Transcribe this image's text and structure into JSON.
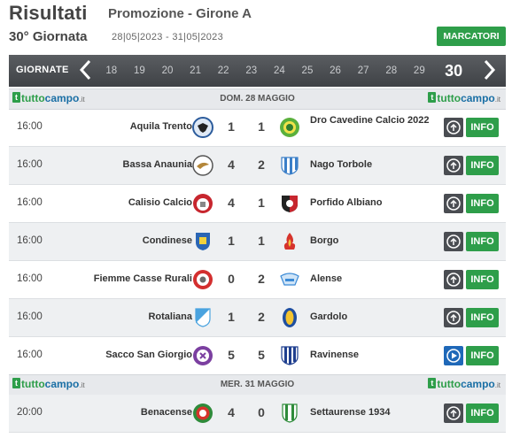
{
  "header": {
    "title": "Risultati",
    "subtitle": "Promozione - Girone A",
    "round_label": "30° Giornata",
    "date_range": "28|05|2023 - 31|05|2023",
    "scorers_button": "MARCATORI"
  },
  "round_nav": {
    "label": "GIORNATE",
    "rounds": [
      "18",
      "19",
      "20",
      "21",
      "22",
      "23",
      "24",
      "25",
      "26",
      "27",
      "28",
      "29"
    ],
    "current": "30"
  },
  "brand": {
    "name_a": "tutto",
    "name_b": "campo",
    "suffix": ".it"
  },
  "days": [
    {
      "label": "DOM. 28 MAGGIO"
    },
    {
      "label": "MER. 31 MAGGIO"
    }
  ],
  "matches": [
    {
      "time": "16:00",
      "home": "Aquila Trento",
      "home_goals": "1",
      "away_goals": "1",
      "away": "Dro Cavedine Calcio 2022",
      "home_logo": "eagle-crest-icon",
      "away_logo": "green-circle-crest-icon",
      "action_icon": "upload-icon",
      "info": "INFO"
    },
    {
      "time": "16:00",
      "home": "Bassa Anaunia",
      "home_goals": "4",
      "away_goals": "2",
      "away": "Nago Torbole",
      "home_logo": "bird-crest-icon",
      "away_logo": "blue-white-shield-icon",
      "action_icon": "upload-icon",
      "info": "INFO"
    },
    {
      "time": "16:00",
      "home": "Calisio Calcio",
      "home_goals": "4",
      "away_goals": "1",
      "away": "Porfido Albiano",
      "home_logo": "red-white-crest-icon",
      "away_logo": "black-red-shield-icon",
      "action_icon": "upload-icon",
      "info": "INFO"
    },
    {
      "time": "16:00",
      "home": "Condinese",
      "home_goals": "1",
      "away_goals": "1",
      "away": "Borgo",
      "home_logo": "blue-shield-icon",
      "away_logo": "red-flame-crest-icon",
      "action_icon": "upload-icon",
      "info": "INFO"
    },
    {
      "time": "16:00",
      "home": "Fiemme Casse Rurali",
      "home_goals": "0",
      "away_goals": "2",
      "away": "Alense",
      "home_logo": "red-ring-crest-icon",
      "away_logo": "light-blue-wing-crest-icon",
      "action_icon": "upload-icon",
      "info": "INFO"
    },
    {
      "time": "16:00",
      "home": "Rotaliana",
      "home_goals": "1",
      "away_goals": "2",
      "away": "Gardolo",
      "home_logo": "sky-blue-shield-icon",
      "away_logo": "yellow-blue-crest-icon",
      "action_icon": "upload-icon",
      "info": "INFO"
    },
    {
      "time": "16:00",
      "home": "Sacco San Giorgio",
      "home_goals": "5",
      "away_goals": "5",
      "away": "Ravinense",
      "home_logo": "purple-ring-crest-icon",
      "away_logo": "blue-stripes-shield-icon",
      "action_icon": "play-icon",
      "info": "INFO"
    },
    {
      "time": "20:00",
      "home": "Benacense",
      "home_goals": "4",
      "away_goals": "0",
      "away": "Settaurense 1934",
      "home_logo": "red-green-crest-icon",
      "away_logo": "green-white-stripes-icon",
      "action_icon": "upload-icon",
      "info": "INFO"
    }
  ]
}
